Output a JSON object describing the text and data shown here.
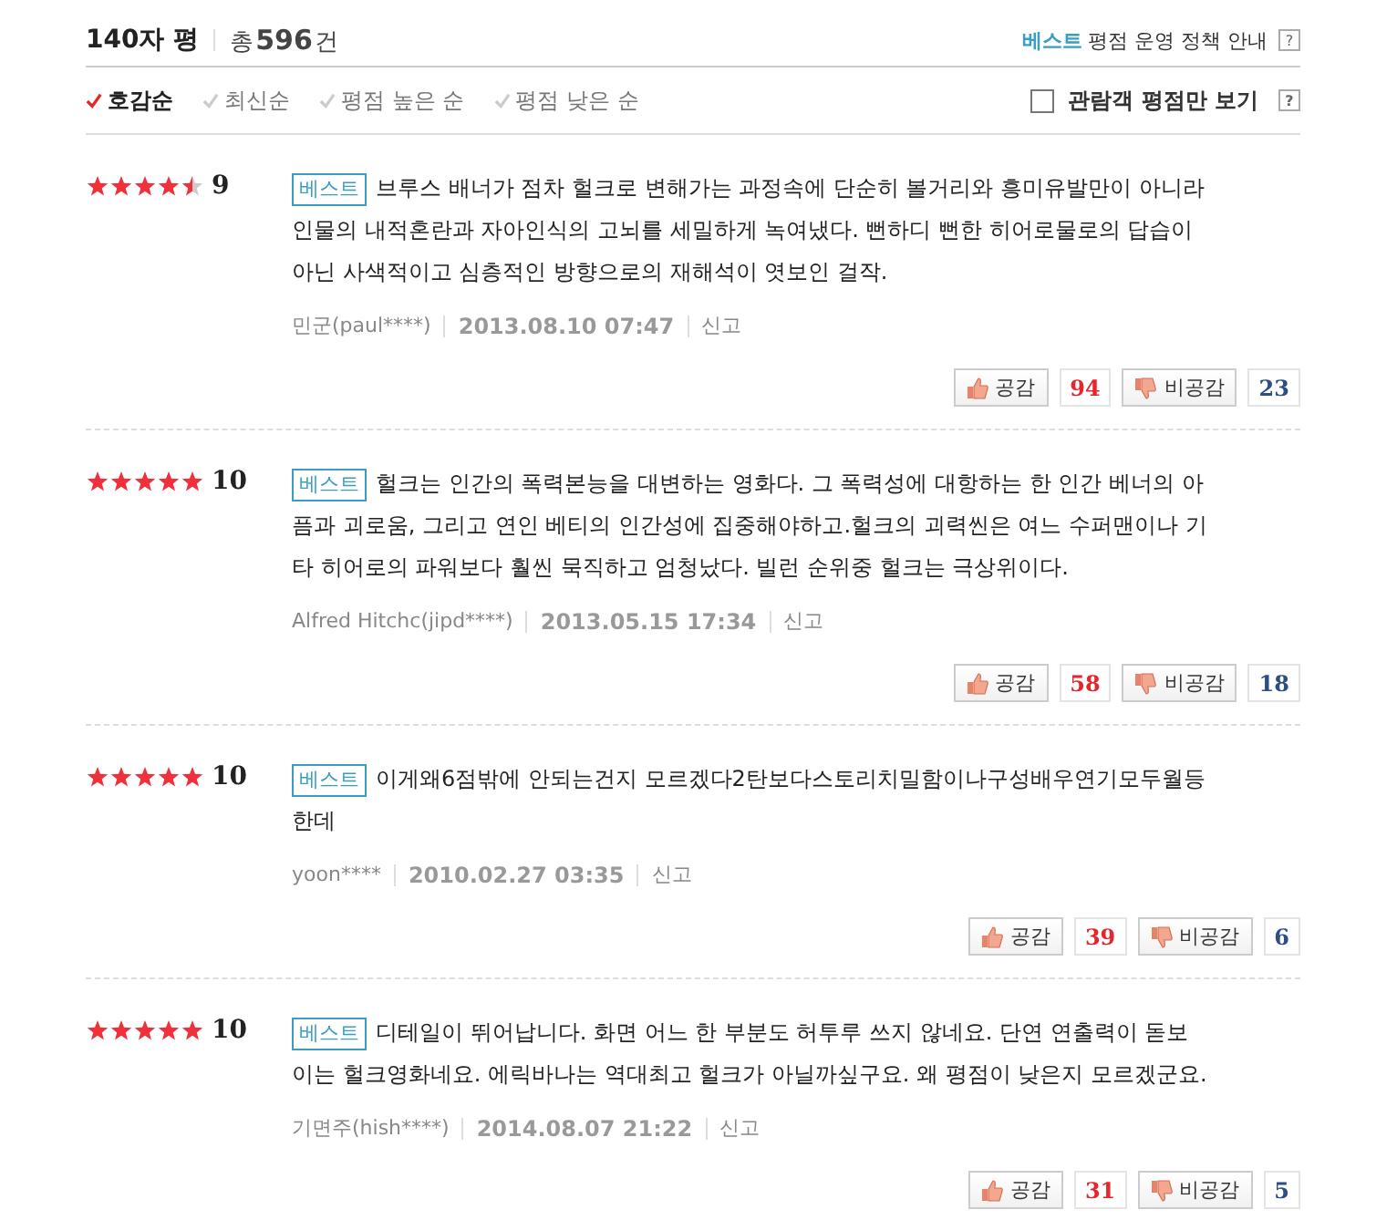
{
  "header": {
    "title": "140자 평",
    "total_prefix": "총",
    "total_count": "596",
    "total_suffix": "건",
    "policy_badge": "베스트",
    "policy_text": "평점 운영 정책 안내",
    "policy_help": "?"
  },
  "sort_options": [
    {
      "label": "호감순",
      "selected": true
    },
    {
      "label": "최신순",
      "selected": false
    },
    {
      "label": "평점 높은 순",
      "selected": false
    },
    {
      "label": "평점 낮은 순",
      "selected": false
    }
  ],
  "audience_filter": {
    "label": "관람객 평점만 보기",
    "checked": false,
    "help": "?"
  },
  "reviews": [
    {
      "stars": 4.5,
      "score": "9",
      "badge": "베스트",
      "text": "브루스 배너가 점차 헐크로 변해가는 과정속에 단순히 볼거리와 흥미유발만이 아니라 인물의 내적혼란과 자아인식의 고뇌를 세밀하게 녹여냈다. 뻔하디 뻔한 히어로물로의 답습이 아닌 사색적이고 심층적인 방향으로의 재해석이 엿보인 걸작.",
      "author": "민군(paul****)",
      "date": "2013.08.10 07:47",
      "report": "신고",
      "like_label": "공감",
      "likes": "94",
      "dislike_label": "비공감",
      "dislikes": "23"
    },
    {
      "stars": 5,
      "score": "10",
      "badge": "베스트",
      "text": "헐크는 인간의 폭력본능을 대변하는 영화다. 그 폭력성에 대항하는 한 인간 베너의 아픔과 괴로움, 그리고 연인 베티의 인간성에 집중해야하고.헐크의 괴력씬은 여느 수퍼맨이나 기타 히어로의 파워보다 훨씬 묵직하고 엄청났다. 빌런 순위중 헐크는 극상위이다.",
      "author": "Alfred Hitchc(jipd****)",
      "date": "2013.05.15 17:34",
      "report": "신고",
      "like_label": "공감",
      "likes": "58",
      "dislike_label": "비공감",
      "dislikes": "18"
    },
    {
      "stars": 5,
      "score": "10",
      "badge": "베스트",
      "text": "이게왜6점밖에 안되는건지 모르겠다2탄보다스토리치밀함이나구성배우연기모두월등한데",
      "author": "yoon****",
      "date": "2010.02.27 03:35",
      "report": "신고",
      "like_label": "공감",
      "likes": "39",
      "dislike_label": "비공감",
      "dislikes": "6"
    },
    {
      "stars": 5,
      "score": "10",
      "badge": "베스트",
      "text": "디테일이 뛰어납니다. 화면 어느 한 부분도 허투루 쓰지 않네요. 단연 연출력이 돋보이는 헐크영화네요. 에릭바나는 역대최고 헐크가 아닐까싶구요. 왜 평점이 낮은지 모르겠군요.",
      "author": "기면주(hish****)",
      "date": "2014.08.07 21:22",
      "report": "신고",
      "like_label": "공감",
      "likes": "31",
      "dislike_label": "비공감",
      "dislikes": "5"
    }
  ]
}
